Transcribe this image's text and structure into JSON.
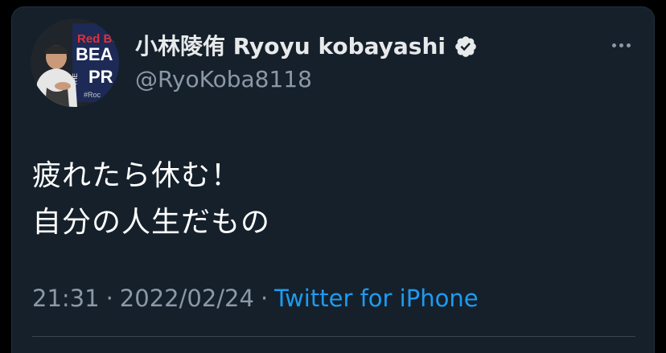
{
  "tweet": {
    "author_name": "小林陵侑 Ryoyu kobayashi",
    "author_handle": "@RyoKoba8118",
    "verified": true,
    "text_lines": [
      "疲れたら休む！",
      "自分の人生だもの"
    ],
    "time": "21:31",
    "separator": "·",
    "date": "2022/02/24",
    "source": "Twitter for iPhone"
  },
  "avatar": {
    "logo_text_line1": "Red Bu",
    "logo_text_line2": "BEA",
    "logo_text_line3": "THE",
    "logo_text_line4": "PR",
    "logo_text_line5": "#Roc"
  },
  "colors": {
    "background": "#15202b",
    "name": "#e7e9ea",
    "secondary": "#8b98a5",
    "link": "#1d9bf0",
    "text": "#ffffff"
  }
}
